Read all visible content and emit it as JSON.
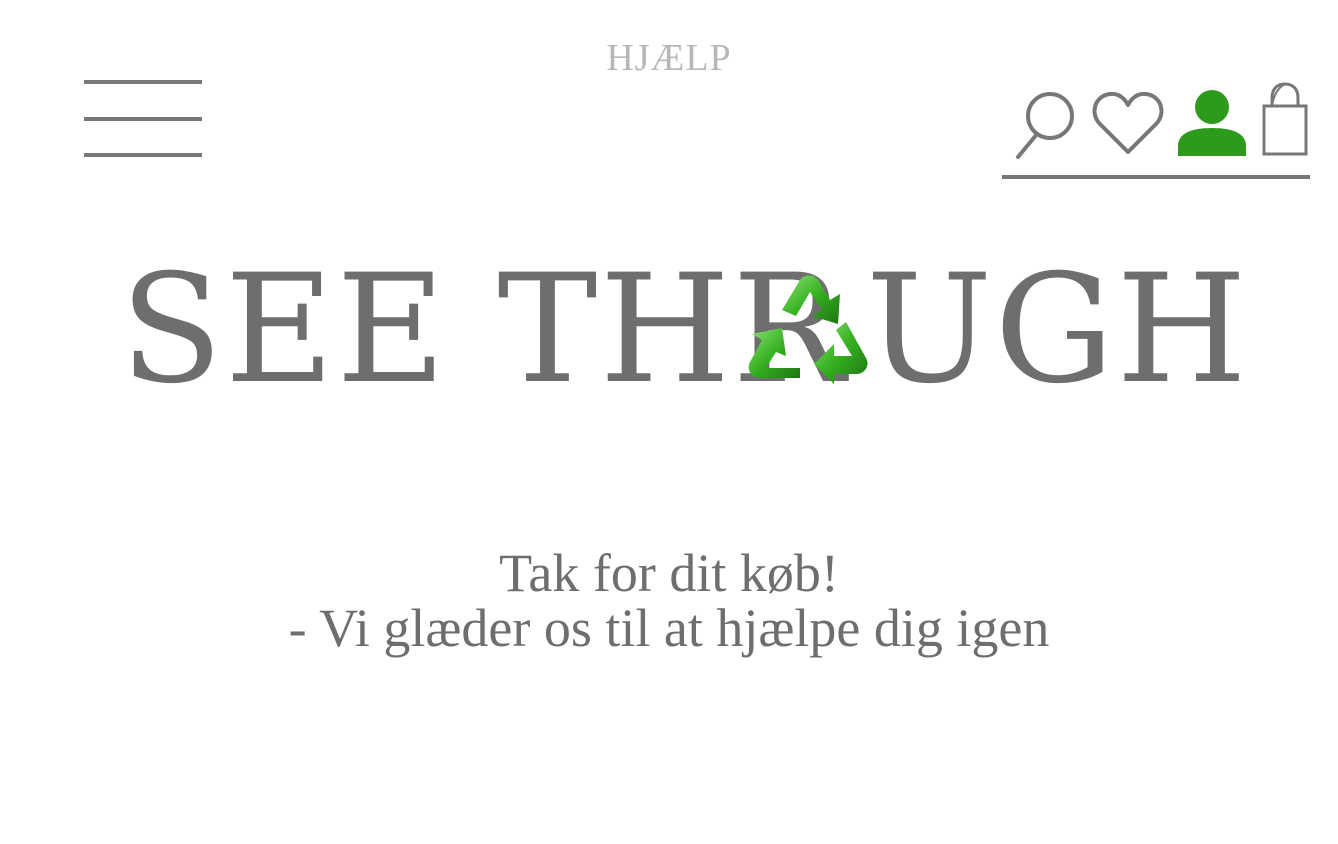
{
  "header": {
    "help_label": "HJÆLP",
    "icons": {
      "menu": "menu-icon",
      "search": "search-icon",
      "favorites": "heart-icon",
      "account": "user-icon",
      "bag": "shopping-bag-icon"
    },
    "account_color": "#2e9a1c",
    "icon_color": "#777777"
  },
  "logo": {
    "text_before": "SEE THR",
    "text_after": "UGH",
    "symbol": "recycle-icon",
    "symbol_color": "#2e9a1c"
  },
  "message": {
    "line1": "Tak for dit køb!",
    "line2": "- Vi glæder os til at hjælpe dig igen"
  }
}
